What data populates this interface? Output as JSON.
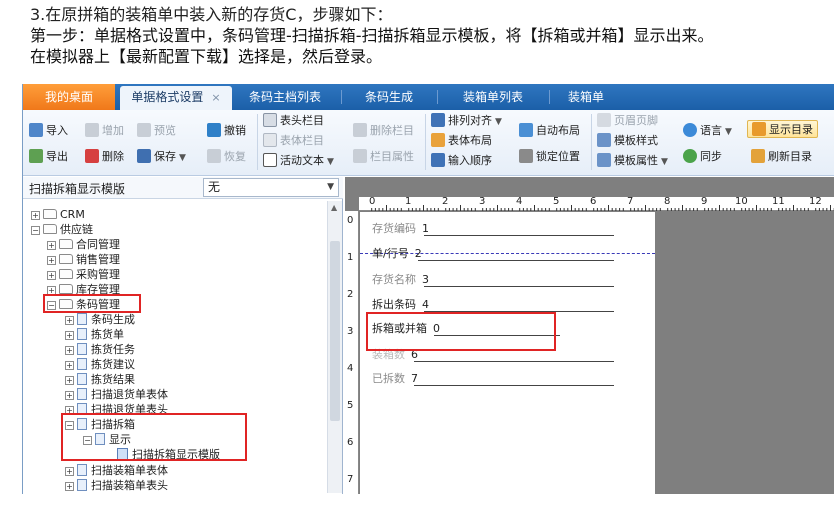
{
  "instructions": {
    "line1": "3.在原拼箱的装箱单中装入新的存货C，步骤如下：",
    "line2": "第一步：单据格式设置中，条码管理-扫描拆箱-扫描拆箱显示模板，将【拆箱或并箱】显示出来。",
    "line3": "在模拟器上【最新配置下载】选择是，然后登录。"
  },
  "tabs": {
    "home": "我的桌面",
    "active": "单据格式设置",
    "close": "×",
    "t1": "条码主档列表",
    "t2": "条码生成",
    "t3": "装箱单列表",
    "t4": "装箱单"
  },
  "ribbon": {
    "import": "导入",
    "add": "增加",
    "preview": "预览",
    "undo": "撤销",
    "export": "导出",
    "delete": "删除",
    "save": "保存",
    "restore": "恢复",
    "header_col": "表头栏目",
    "body_col": "表体栏目",
    "active_text": "活动文本",
    "del_col": "删除栏目",
    "col_prop": "栏目属性",
    "align": "排列对齐",
    "body_layout": "表体布局",
    "input_order": "输入顺序",
    "auto_layout": "自动布局",
    "lock_pos": "锁定位置",
    "page_header": "页眉页脚",
    "tpl_style": "模板样式",
    "tpl_prop": "模板属性",
    "language": "语言",
    "sync": "同步",
    "show_dir": "显示目录",
    "refresh_dir": "刷新目录"
  },
  "template_select": {
    "label": "扫描拆箱显示模版",
    "value": "无"
  },
  "tree": {
    "crm": "CRM",
    "supply": "供应链",
    "contract": "合同管理",
    "sales": "销售管理",
    "purchase": "采购管理",
    "stock": "库存管理",
    "barcode": "条码管理",
    "gen": "条码生成",
    "pick": "拣货单",
    "pick_task": "拣货任务",
    "pick_suggest": "拣货建议",
    "pick_result": "拣货结果",
    "scan_return_body": "扫描退货单表体",
    "scan_return_head": "扫描退货单表头",
    "scan_unpack": "扫描拆箱",
    "display": "显示",
    "unpack_tpl": "扫描拆箱显示模版",
    "scan_pack_body": "扫描装箱单表体",
    "scan_pack_head": "扫描装箱单表头"
  },
  "form": {
    "f1": "存货编码",
    "n1": "1",
    "f2": "单/行号",
    "n2": "2",
    "f3": "存货名称",
    "n3": "3",
    "f4": "拆出条码",
    "n4": "4",
    "f5": "拆箱或并箱",
    "n5": "0",
    "f6": "装箱数",
    "n6": "6",
    "f7": "已拆数",
    "n7": "7"
  },
  "ruler": {
    "top": [
      "0",
      "1",
      "2",
      "3",
      "4",
      "5",
      "6",
      "7",
      "8",
      "9",
      "10",
      "11",
      "12"
    ],
    "left": [
      "0",
      "1",
      "2",
      "3",
      "4",
      "5",
      "6",
      "7"
    ]
  }
}
